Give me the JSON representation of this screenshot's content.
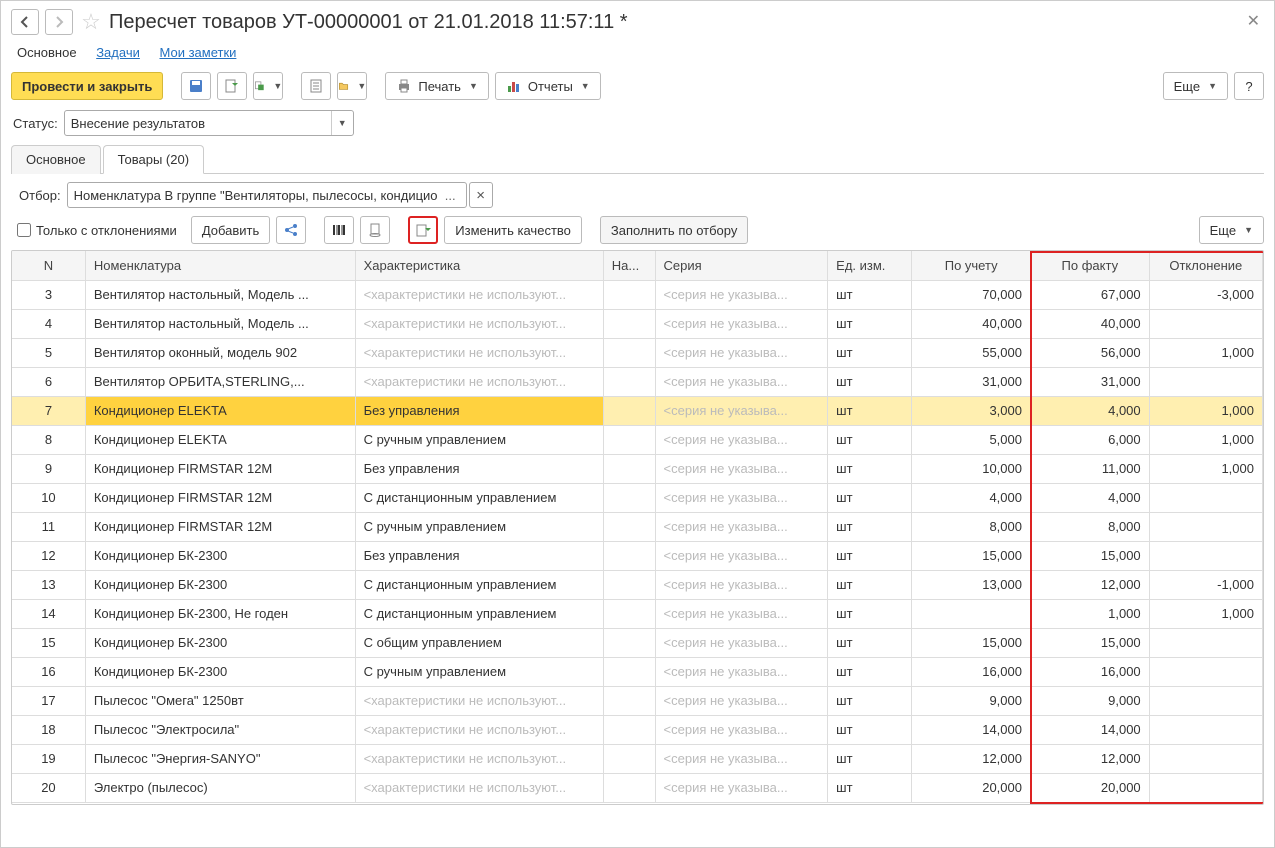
{
  "header": {
    "title": "Пересчет товаров УТ-00000001 от 21.01.2018 11:57:11 *"
  },
  "top_links": {
    "main": "Основное",
    "tasks": "Задачи",
    "notes": "Мои заметки"
  },
  "toolbar": {
    "post_close": "Провести и закрыть",
    "print": "Печать",
    "reports": "Отчеты",
    "more": "Еще",
    "help": "?"
  },
  "status": {
    "label": "Статус:",
    "value": "Внесение результатов"
  },
  "tabs": {
    "main": "Основное",
    "goods": "Товары (20)"
  },
  "filter": {
    "label": "Отбор:",
    "value": "Номенклатура В группе \"Вентиляторы, пылесосы, кондицио"
  },
  "table_toolbar": {
    "only_dev": "Только с отклонениями",
    "add": "Добавить",
    "change_quality": "Изменить качество",
    "fill_by_filter": "Заполнить по отбору",
    "more": "Еще"
  },
  "columns": {
    "n": "N",
    "nom": "Номенклатура",
    "char": "Характеристика",
    "na": "На...",
    "ser": "Серия",
    "ed": "Ед. изм.",
    "acc": "По учету",
    "fact": "По факту",
    "dev": "Отклонение"
  },
  "placeholders": {
    "char": "<характеристики не используют...",
    "ser": "<серия не указыва..."
  },
  "rows": [
    {
      "n": "3",
      "nom": "Вентилятор настольный, Модель ...",
      "char": "",
      "ser": "",
      "ed": "шт",
      "acc": "70,000",
      "fact": "67,000",
      "dev": "-3,000",
      "selected": false
    },
    {
      "n": "4",
      "nom": "Вентилятор настольный, Модель ...",
      "char": "",
      "ser": "",
      "ed": "шт",
      "acc": "40,000",
      "fact": "40,000",
      "dev": "",
      "selected": false
    },
    {
      "n": "5",
      "nom": "Вентилятор оконный, модель 902",
      "char": "",
      "ser": "",
      "ed": "шт",
      "acc": "55,000",
      "fact": "56,000",
      "dev": "1,000",
      "selected": false
    },
    {
      "n": "6",
      "nom": "Вентилятор ОРБИТА,STERLING,...",
      "char": "",
      "ser": "",
      "ed": "шт",
      "acc": "31,000",
      "fact": "31,000",
      "dev": "",
      "selected": false
    },
    {
      "n": "7",
      "nom": "Кондиционер ELEKTA",
      "char": "Без управления",
      "ser": "",
      "ed": "шт",
      "acc": "3,000",
      "fact": "4,000",
      "dev": "1,000",
      "selected": true
    },
    {
      "n": "8",
      "nom": "Кондиционер ELEKTA",
      "char": "С ручным управлением",
      "ser": "",
      "ed": "шт",
      "acc": "5,000",
      "fact": "6,000",
      "dev": "1,000",
      "selected": false
    },
    {
      "n": "9",
      "nom": "Кондиционер FIRMSTAR 12M",
      "char": "Без управления",
      "ser": "",
      "ed": "шт",
      "acc": "10,000",
      "fact": "11,000",
      "dev": "1,000",
      "selected": false
    },
    {
      "n": "10",
      "nom": "Кондиционер FIRMSTAR 12M",
      "char": "С дистанционным управлением",
      "ser": "",
      "ed": "шт",
      "acc": "4,000",
      "fact": "4,000",
      "dev": "",
      "selected": false
    },
    {
      "n": "11",
      "nom": "Кондиционер FIRMSTAR 12M",
      "char": "С ручным управлением",
      "ser": "",
      "ed": "шт",
      "acc": "8,000",
      "fact": "8,000",
      "dev": "",
      "selected": false
    },
    {
      "n": "12",
      "nom": "Кондиционер БК-2300",
      "char": "Без управления",
      "ser": "",
      "ed": "шт",
      "acc": "15,000",
      "fact": "15,000",
      "dev": "",
      "selected": false
    },
    {
      "n": "13",
      "nom": "Кондиционер БК-2300",
      "char": "С дистанционным управлением",
      "ser": "",
      "ed": "шт",
      "acc": "13,000",
      "fact": "12,000",
      "dev": "-1,000",
      "selected": false
    },
    {
      "n": "14",
      "nom": "Кондиционер БК-2300, Не годен",
      "char": "С дистанционным управлением",
      "ser": "",
      "ed": "шт",
      "acc": "",
      "fact": "1,000",
      "dev": "1,000",
      "selected": false
    },
    {
      "n": "15",
      "nom": "Кондиционер БК-2300",
      "char": "С общим управлением",
      "ser": "",
      "ed": "шт",
      "acc": "15,000",
      "fact": "15,000",
      "dev": "",
      "selected": false
    },
    {
      "n": "16",
      "nom": "Кондиционер БК-2300",
      "char": "С ручным управлением",
      "ser": "",
      "ed": "шт",
      "acc": "16,000",
      "fact": "16,000",
      "dev": "",
      "selected": false
    },
    {
      "n": "17",
      "nom": "Пылесос \"Омега\" 1250вт",
      "char": "",
      "ser": "",
      "ed": "шт",
      "acc": "9,000",
      "fact": "9,000",
      "dev": "",
      "selected": false
    },
    {
      "n": "18",
      "nom": "Пылесос \"Электросила\"",
      "char": "",
      "ser": "",
      "ed": "шт",
      "acc": "14,000",
      "fact": "14,000",
      "dev": "",
      "selected": false
    },
    {
      "n": "19",
      "nom": "Пылесос \"Энергия-SANYO\"",
      "char": "",
      "ser": "",
      "ed": "шт",
      "acc": "12,000",
      "fact": "12,000",
      "dev": "",
      "selected": false
    },
    {
      "n": "20",
      "nom": "Электро (пылесос)",
      "char": "",
      "ser": "",
      "ed": "шт",
      "acc": "20,000",
      "fact": "20,000",
      "dev": "",
      "selected": false
    }
  ]
}
